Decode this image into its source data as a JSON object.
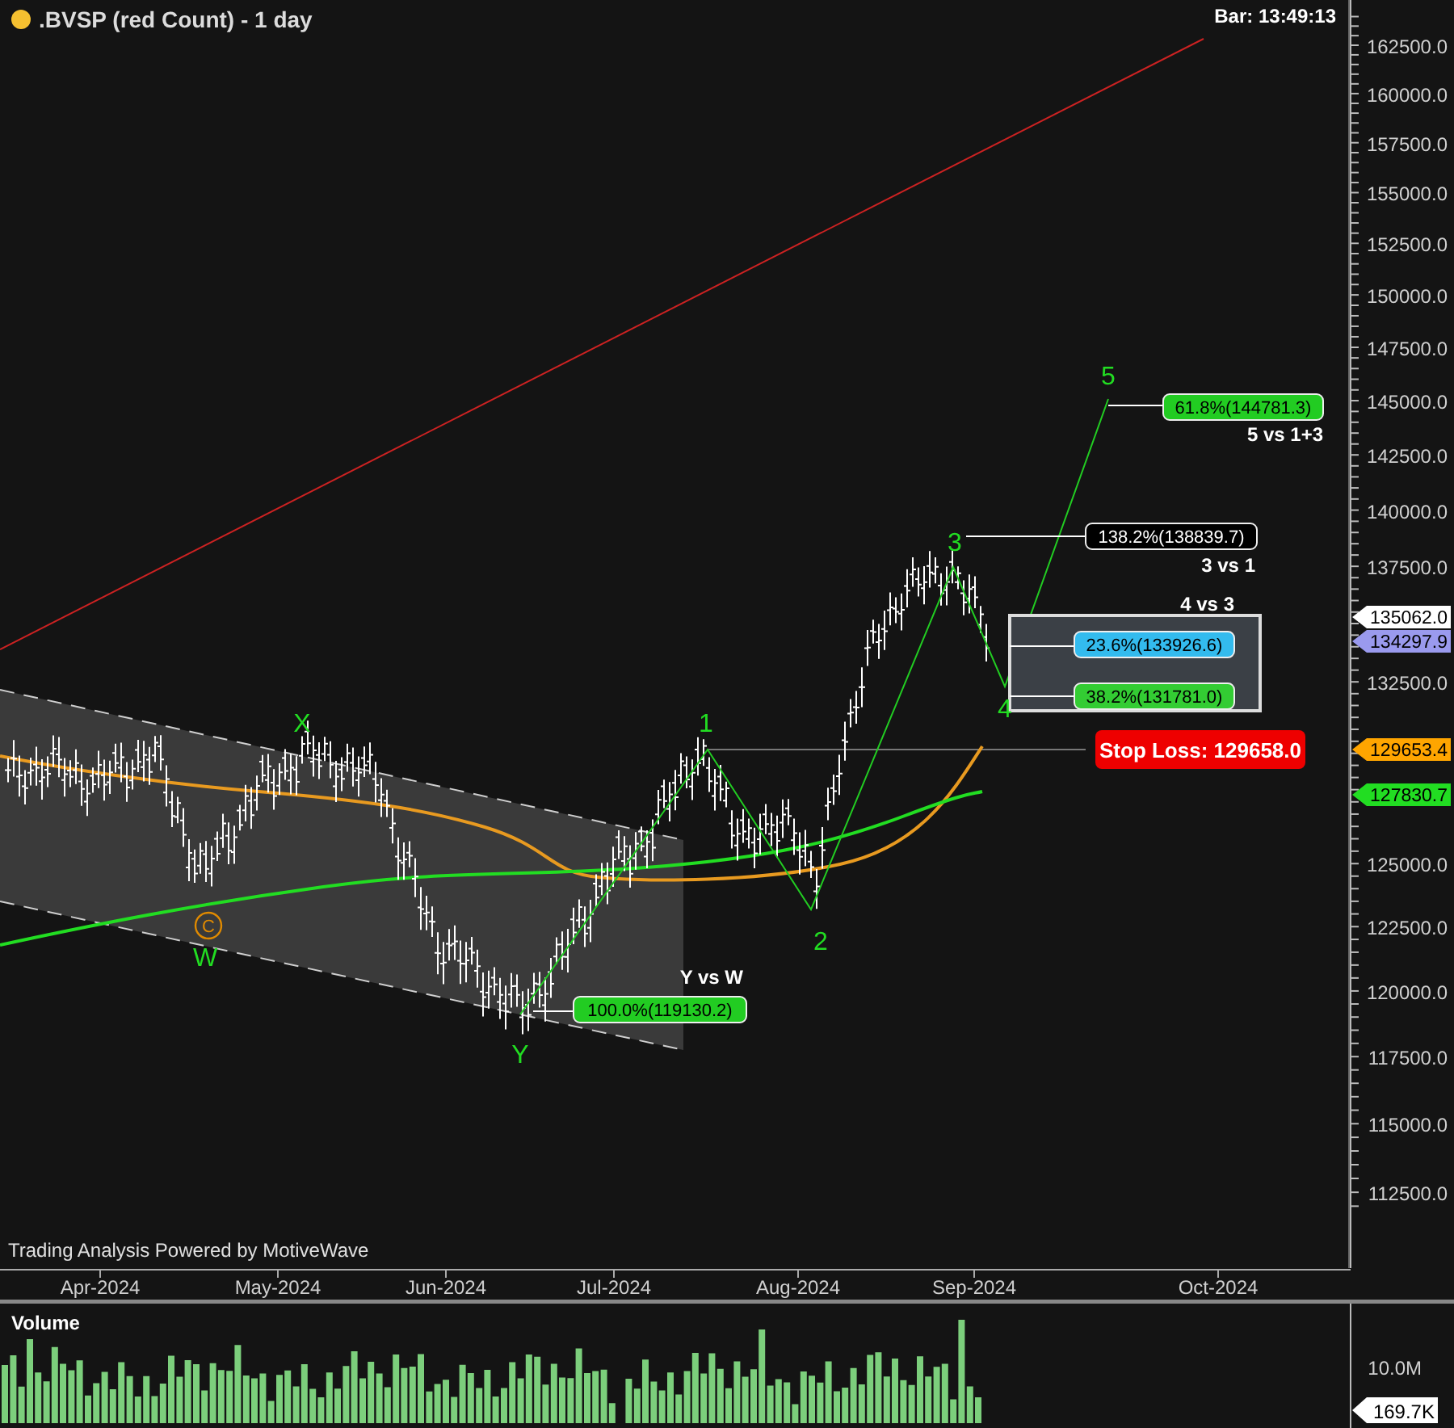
{
  "chart": {
    "title": ".BVSP (red Count) - 1 day",
    "bar_time": "Bar: 13:49:13",
    "credit": "Trading Analysis Powered by MotiveWave",
    "y_axis": {
      "ticks": [
        "162500.0",
        "160000.0",
        "157500.0",
        "155000.0",
        "152500.0",
        "150000.0",
        "147500.0",
        "145000.0",
        "142500.0",
        "140000.0",
        "137500.0",
        "132500.0",
        "125000.0",
        "122500.0",
        "120000.0",
        "117500.0",
        "115000.0",
        "112500.0"
      ]
    },
    "price_tags": [
      {
        "text": "135062.0",
        "color": "#ffffff"
      },
      {
        "text": "134297.9",
        "color": "#9a9aee"
      },
      {
        "text": "129653.4",
        "color": "#ffa500"
      },
      {
        "text": "127830.7",
        "color": "#22dd22"
      }
    ],
    "wave_labels": [
      {
        "text": "C",
        "kind": "circled",
        "color": "#e08a00"
      },
      {
        "text": "W",
        "kind": "plain",
        "color": "#22dd22"
      },
      {
        "text": "X",
        "kind": "plain",
        "color": "#22dd22"
      },
      {
        "text": "Y",
        "kind": "plain",
        "color": "#22dd22"
      },
      {
        "text": "1",
        "kind": "plain",
        "color": "#22dd22"
      },
      {
        "text": "2",
        "kind": "plain",
        "color": "#22dd22"
      },
      {
        "text": "3",
        "kind": "plain",
        "color": "#22dd22"
      },
      {
        "text": "4",
        "kind": "plain",
        "color": "#22dd22"
      },
      {
        "text": "5",
        "kind": "plain",
        "color": "#22dd22"
      }
    ],
    "fib_labels": [
      {
        "text": "61.8%(144781.3)",
        "color": "#22cc22",
        "note": "5 vs 1+3"
      },
      {
        "text": "138.2%(138839.7)",
        "color": "#000000",
        "note": "3 vs 1"
      },
      {
        "text": "23.6%(133926.6)",
        "color": "#33bbee"
      },
      {
        "text": "38.2%(131781.0)",
        "color": "#33cc33"
      },
      {
        "text": "100.0%(119130.2)",
        "color": "#22cc22",
        "note": "Y vs W"
      }
    ],
    "zone_note": "4 vs 3",
    "stop_loss": "Stop Loss: 129658.0",
    "x_axis": {
      "labels": [
        "Apr-2024",
        "May-2024",
        "Jun-2024",
        "Jul-2024",
        "Aug-2024",
        "Sep-2024",
        "Oct-2024"
      ]
    }
  },
  "volume_panel": {
    "title": "Volume",
    "ticks": [
      "10.0M"
    ],
    "price_tag": "169.7K"
  }
}
